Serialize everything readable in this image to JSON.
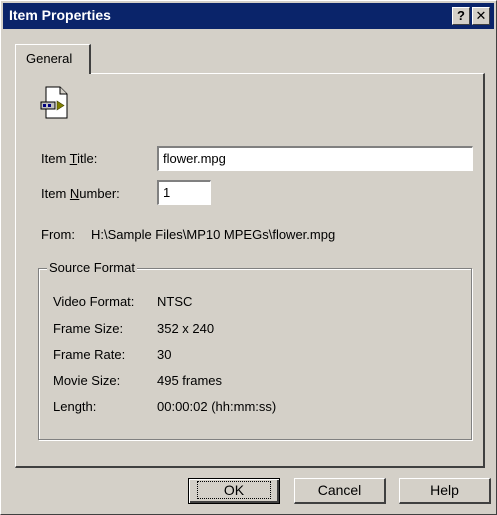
{
  "window": {
    "title": "Item Properties",
    "help_button": "?",
    "close_button": "✕"
  },
  "tabs": [
    {
      "label": "General"
    }
  ],
  "general": {
    "icon": "video-file-icon",
    "item_title_label": {
      "pre": "Item ",
      "accel": "T",
      "post": "itle:"
    },
    "item_title_value": "flower.mpg",
    "item_number_label": {
      "pre": "Item ",
      "accel": "N",
      "post": "umber:"
    },
    "item_number_value": "1",
    "from_label": "From:",
    "from_value": "H:\\Sample Files\\MP10 MPEGs\\flower.mpg"
  },
  "source_format": {
    "title": "Source Format",
    "rows": [
      {
        "label": "Video Format:",
        "value": "NTSC"
      },
      {
        "label": "Frame Size:",
        "value": "352 x 240"
      },
      {
        "label": "Frame Rate:",
        "value": "30"
      },
      {
        "label": "Movie Size:",
        "value": "495 frames"
      },
      {
        "label": "Length:",
        "value": "00:00:02 (hh:mm:ss)"
      }
    ]
  },
  "buttons": {
    "ok": "OK",
    "cancel": "Cancel",
    "help": "Help"
  },
  "colors": {
    "titlebar": "#0a246a",
    "face": "#d4d0c8"
  }
}
